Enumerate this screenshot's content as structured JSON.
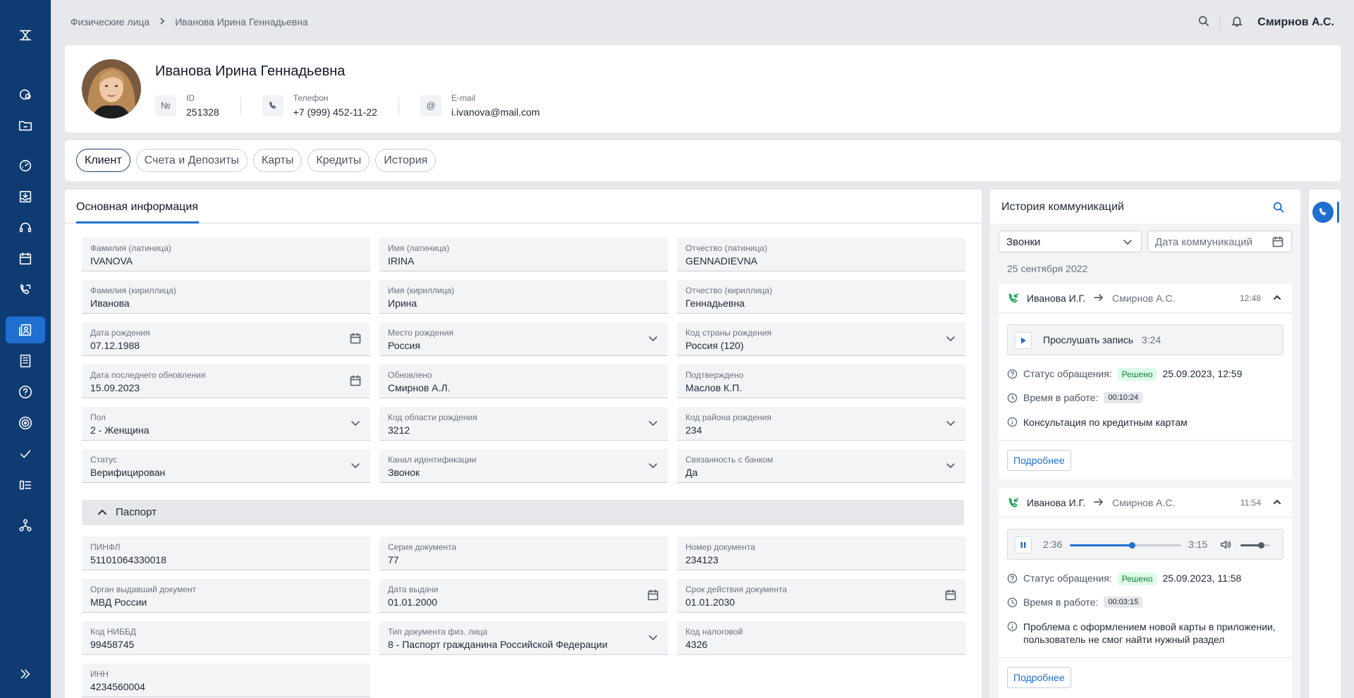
{
  "breadcrumb": {
    "root": "Физические лица",
    "current": "Иванова Ирина Геннадьевна"
  },
  "topbar": {
    "user": "Смирнов А.С."
  },
  "profile": {
    "name": "Иванова Ирина Геннадьевна",
    "id_badge": "№",
    "id_label": "ID",
    "id_value": "251328",
    "phone_label": "Телефон",
    "phone_value": "+7 (999) 452-11-22",
    "email_badge": "@",
    "email_label": "E-mail",
    "email_value": "i.ivanova@mail.com"
  },
  "tabs": [
    "Клиент",
    "Счета и Депозиты",
    "Карты",
    "Кредиты",
    "История"
  ],
  "main": {
    "title": "Основная информация",
    "fields": [
      {
        "label": "Фамилия (латиница)",
        "value": "IVANOVA",
        "icon": ""
      },
      {
        "label": "Имя (латиница)",
        "value": "IRINA",
        "icon": ""
      },
      {
        "label": "Отчество (латиница)",
        "value": "GENNADIEVNA",
        "icon": ""
      },
      {
        "label": "Фамилия (кириллица)",
        "value": "Иванова",
        "icon": ""
      },
      {
        "label": "Имя (кириллица)",
        "value": "Ирина",
        "icon": ""
      },
      {
        "label": "Отчество (кириллица)",
        "value": "Геннадьевна",
        "icon": ""
      },
      {
        "label": "Дата рождения",
        "value": "07.12.1988",
        "icon": "calendar"
      },
      {
        "label": "Место рождения",
        "value": "Россия",
        "icon": "chevron"
      },
      {
        "label": "Код страны рождения",
        "value": "Россия (120)",
        "icon": "chevron"
      },
      {
        "label": "Дата последнего обновления",
        "value": "15.09.2023",
        "icon": "calendar"
      },
      {
        "label": "Обновлено",
        "value": "Смирнов А.Л.",
        "icon": ""
      },
      {
        "label": "Подтверждено",
        "value": "Маслов К.П.",
        "icon": ""
      },
      {
        "label": "Пол",
        "value": "2 - Женщина",
        "icon": "chevron"
      },
      {
        "label": "Код области рождения",
        "value": "3212",
        "icon": "chevron"
      },
      {
        "label": "Код района рождения",
        "value": "234",
        "icon": "chevron"
      },
      {
        "label": "Статус",
        "value": "Верифицирован",
        "icon": "chevron"
      },
      {
        "label": "Канал идентификации",
        "value": "Звонок",
        "icon": "chevron"
      },
      {
        "label": "Связанность с банком",
        "value": "Да",
        "icon": "chevron"
      }
    ],
    "passport_title": "Паспорт",
    "passport_fields": [
      {
        "label": "ПИНФЛ",
        "value": "51101064330018",
        "icon": ""
      },
      {
        "label": "Серия документа",
        "value": "77",
        "icon": ""
      },
      {
        "label": "Номер документа",
        "value": "234123",
        "icon": ""
      },
      {
        "label": "Орган выдавший документ",
        "value": "МВД России",
        "icon": ""
      },
      {
        "label": "Дата выдачи",
        "value": "01.01.2000",
        "icon": "calendar"
      },
      {
        "label": "Срок действия документа",
        "value": "01.01.2030",
        "icon": "calendar"
      },
      {
        "label": "Код НИББД",
        "value": "99458745",
        "icon": ""
      },
      {
        "label": "Тип документа физ. лица",
        "value": "8 - Паспорт гражданина Российской Федерации",
        "icon": "chevron"
      },
      {
        "label": "Код налоговой",
        "value": "4326",
        "icon": ""
      },
      {
        "label": "ИНН",
        "value": "4234560004",
        "icon": ""
      }
    ]
  },
  "history": {
    "title": "История коммуникаций",
    "filter_type": "Звонки",
    "filter_date_placeholder": "Дата коммуникаций",
    "date": "25 сентября 2022",
    "items": [
      {
        "from": "Иванова И.Г.",
        "to": "Смирнов А.С.",
        "time": "12:48",
        "listen_label": "Прослушать запись",
        "duration": "3:24",
        "status_label": "Статус обращения:",
        "status": "Решено",
        "status_time": "25.09.2023, 12:59",
        "work_label": "Время в работе:",
        "work_time": "00:10:24",
        "description": "Консультация по кредитным картам",
        "more": "Подробнее"
      },
      {
        "from": "Иванова И.Г.",
        "to": "Смирнов А.С.",
        "time": "11:54",
        "current": "2:36",
        "total": "3:15",
        "progress": 0.56,
        "volume": 0.7,
        "status_label": "Статус обращения:",
        "status": "Решено",
        "status_time": "25.09.2023, 11:58",
        "work_label": "Время в работе:",
        "work_time": "00:03:15",
        "description": "Проблема с оформлением новой карты в приложении, пользователь не смог найти нужный раздел",
        "more": "Подробнее"
      }
    ]
  },
  "colors": {
    "rail": "#0f3b73",
    "accent": "#1f6fd1",
    "success": "#15a34a"
  }
}
